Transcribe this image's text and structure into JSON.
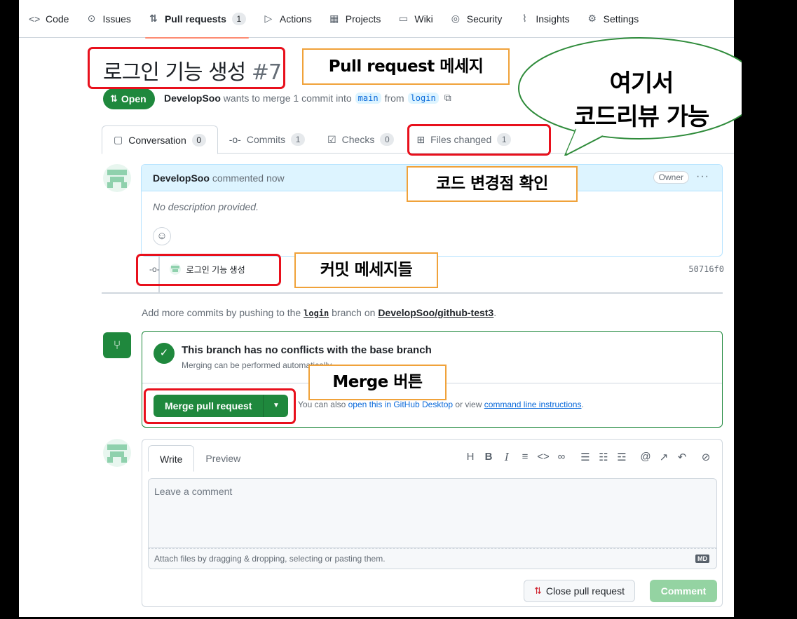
{
  "nav": {
    "items": [
      {
        "icon": "code-icon",
        "glyph": "<>",
        "label": "Code"
      },
      {
        "icon": "issue-icon",
        "glyph": "⊙",
        "label": "Issues"
      },
      {
        "icon": "pull-request-icon",
        "glyph": "⇅",
        "label": "Pull requests",
        "count": "1",
        "active": true
      },
      {
        "icon": "play-icon",
        "glyph": "▷",
        "label": "Actions"
      },
      {
        "icon": "table-icon",
        "glyph": "▦",
        "label": "Projects"
      },
      {
        "icon": "book-icon",
        "glyph": "▭",
        "label": "Wiki"
      },
      {
        "icon": "shield-icon",
        "glyph": "◎",
        "label": "Security"
      },
      {
        "icon": "graph-icon",
        "glyph": "⌇",
        "label": "Insights"
      },
      {
        "icon": "gear-icon",
        "glyph": "⚙",
        "label": "Settings"
      }
    ]
  },
  "pr": {
    "title": "로그인 기능 생성",
    "number": "#7",
    "state": "Open",
    "author": "DevelopSoo",
    "merge_text": "wants to merge 1 commit into",
    "base_branch": "main",
    "from_text": "from",
    "head_branch": "login"
  },
  "tabs": [
    {
      "label": "Conversation",
      "count": "0"
    },
    {
      "label": "Commits",
      "count": "1"
    },
    {
      "label": "Checks",
      "count": "0"
    },
    {
      "label": "Files changed",
      "count": "1"
    }
  ],
  "comment": {
    "author": "DevelopSoo",
    "time": "commented now",
    "badge": "Owner",
    "body": "No description provided."
  },
  "commit": {
    "message": "로그인 기능 생성",
    "sha": "50716f0"
  },
  "push_hint": {
    "prefix": "Add more commits by pushing to the",
    "branch": "login",
    "middle": "branch on",
    "repo": "DevelopSoo/github-test3",
    "suffix": "."
  },
  "merge": {
    "title": "This branch has no conflicts with the base branch",
    "subtitle": "Merging can be performed automatically.",
    "button": "Merge pull request",
    "alt_prefix": "You can also",
    "alt_link1": "open this in GitHub Desktop",
    "alt_middle": "or view",
    "alt_link2": "command line instructions",
    "alt_suffix": "."
  },
  "editor": {
    "tab_write": "Write",
    "tab_preview": "Preview",
    "placeholder": "Leave a comment",
    "attach_hint": "Attach files by dragging & dropping, selecting or pasting them.",
    "close_button": "Close pull request",
    "comment_button": "Comment",
    "md_badge": "MD"
  },
  "annotations": {
    "pr_message": "Pull request 메세지",
    "code_changes": "코드 변경점 확인",
    "commit_messages": "커밋 메세지들",
    "merge_button": "Merge 버튼",
    "bubble_line1": "여기서",
    "bubble_line2": "코드리뷰 가능"
  },
  "colors": {
    "accent_green": "#1f883d",
    "highlight_red": "#e8101c",
    "callout_orange": "#f0a23a",
    "link_blue": "#0969da"
  }
}
